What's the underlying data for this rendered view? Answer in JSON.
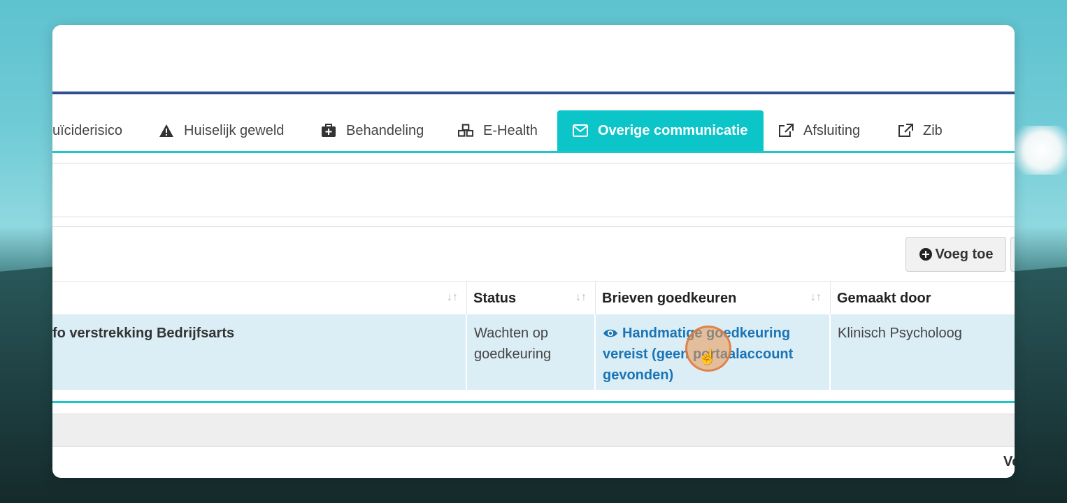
{
  "tabs": [
    {
      "label": "uïciderisico",
      "icon": ""
    },
    {
      "label": "Huiselijk geweld",
      "icon": "warning-icon"
    },
    {
      "label": "Behandeling",
      "icon": "medkit-icon"
    },
    {
      "label": "E-Health",
      "icon": "cubes-icon"
    },
    {
      "label": "Overige communicatie",
      "icon": "envelope-icon",
      "active": true
    },
    {
      "label": "Afsluiting",
      "icon": "external-link-icon"
    },
    {
      "label": "Zib",
      "icon": "external-link-icon"
    }
  ],
  "toolbar": {
    "add_label": "Voeg toe"
  },
  "table": {
    "columns": [
      "",
      "Status",
      "Brieven goedkeuren",
      "Gemaakt door"
    ],
    "rows": [
      {
        "name": "fo verstrekking Bedrijfsarts",
        "status": "Wachten op goedkeuring",
        "approval": "Handmatige goedkeuring vereist (geen portaalaccount gevonden)",
        "created_by": "Klinisch Psycholoog"
      }
    ]
  },
  "footer": {
    "partial_text": "Ve"
  },
  "colors": {
    "accent": "#0bc5c8",
    "primary_rule": "#2f4f8f",
    "link": "#1a74b5",
    "row_highlight": "#dbeef6"
  }
}
